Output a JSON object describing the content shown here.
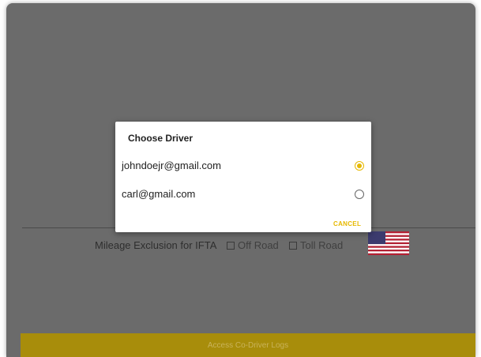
{
  "colors": {
    "overlay": "#6b6b6b",
    "accent": "#e6b800",
    "button": "#a88d0b"
  },
  "background": {
    "mileage_label": "Mileage Exclusion for IFTA",
    "off_road_label": "Off Road",
    "toll_road_label": "Toll Road",
    "flag_icon": "us-flag-icon",
    "bottom_button_label": "Access Co-Driver Logs"
  },
  "dialog": {
    "title": "Choose Driver",
    "options": [
      {
        "label": "johndoejr@gmail.com",
        "selected": true
      },
      {
        "label": "carl@gmail.com",
        "selected": false
      }
    ],
    "cancel_label": "CANCEL"
  }
}
